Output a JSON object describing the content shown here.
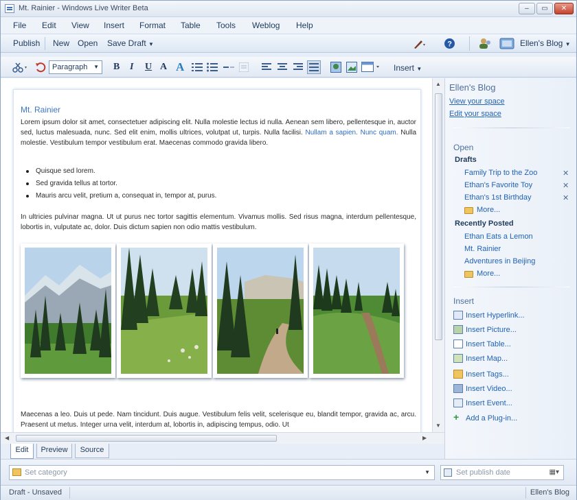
{
  "window": {
    "title": "Mt. Rainier - Windows Live Writer Beta",
    "controls": {
      "minimize": "–",
      "maximize": "▭",
      "close": "✕"
    }
  },
  "menu": [
    "File",
    "Edit",
    "View",
    "Insert",
    "Format",
    "Table",
    "Tools",
    "Weblog",
    "Help"
  ],
  "toolbar": {
    "publish": "Publish",
    "new": "New",
    "open": "Open",
    "save_draft": "Save Draft",
    "blog_name": "Ellen's Blog"
  },
  "format_bar": {
    "style": "Paragraph",
    "bold": "B",
    "italic": "I",
    "underline": "U",
    "font_color": "A",
    "font_size": "A",
    "insert": "Insert"
  },
  "editor": {
    "post_title": "Mt. Rainier",
    "para1_a": "Lorem ipsum dolor sit amet, consectetuer adipiscing elit. Nulla molestie lectus id nulla. Aenean sem libero, pellentesque in, auctor sed, luctus malesuada, nunc. Sed elit enim, mollis ultrices, volutpat ut, turpis. Nulla facilisi. ",
    "para1_link1": "Nullam a sapien.",
    "para1_link2": "Nunc quam.",
    "para1_b": " Nulla molestie. Vestibulum tempor vestibulum erat. Maecenas commodo gravida libero.",
    "bullets": [
      "Quisque sed lorem.",
      "Sed gravida tellus at tortor.",
      "Mauris arcu velit, pretium a, consequat in, tempor at, purus."
    ],
    "para2": "In ultricies pulvinar magna. Ut ut purus nec tortor sagittis elementum. Vivamus mollis. Sed risus magna, interdum pellentesque, lobortis in, vulputate ac, dolor. Duis dictum sapien non odio mattis vestibulum.",
    "para3": "Maecenas a leo. Duis ut pede. Nam tincidunt. Duis augue. Vestibulum felis velit, scelerisque eu, blandit tempor, gravida ac, arcu. Praesent ut metus. Integer urna velit, interdum at, lobortis in, adipiscing tempus, odio. Ut"
  },
  "sidebar": {
    "blog_title": "Ellen's Blog",
    "view_space": "View your space",
    "edit_space": "Edit your space",
    "open_heading": "Open",
    "drafts_label": "Drafts",
    "drafts": [
      "Family Trip to the Zoo",
      "Ethan's Favorite Toy",
      "Ethan's 1st Birthday"
    ],
    "drafts_more": "More...",
    "recent_label": "Recently Posted",
    "recent": [
      "Ethan Eats a Lemon",
      "Mt. Rainier",
      "Adventures in Beijing"
    ],
    "recent_more": "More...",
    "insert_heading": "Insert",
    "insert_items": [
      "Insert Hyperlink...",
      "Insert Picture...",
      "Insert Table...",
      "Insert Map...",
      "Insert Tags...",
      "Insert Video...",
      "Insert Event...",
      "Add a Plug-in..."
    ]
  },
  "tabs": [
    "Edit",
    "Preview",
    "Source"
  ],
  "properties": {
    "category_placeholder": "Set category",
    "date_placeholder": "Set publish date"
  },
  "status": {
    "left": "Draft - Unsaved",
    "right": "Ellen's Blog"
  },
  "colors": {
    "accent": "#3d76c4",
    "link": "#2062b5",
    "chrome": "#e8eef7"
  }
}
